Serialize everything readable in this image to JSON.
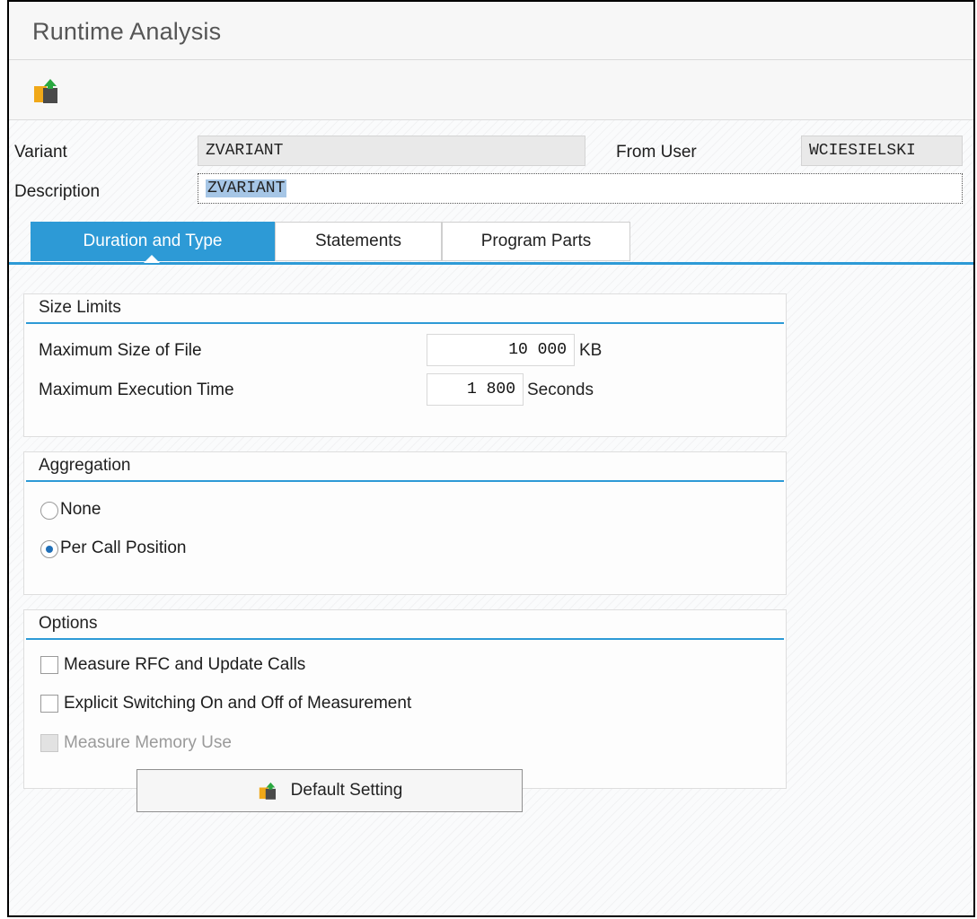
{
  "window": {
    "title": "Runtime Analysis"
  },
  "toolbar": {
    "icon": "get-variant-icon"
  },
  "header": {
    "variant_label": "Variant",
    "variant_value": "ZVARIANT",
    "from_user_label": "From User",
    "from_user_value": "WCIESIELSKI",
    "description_label": "Description",
    "description_value": "ZVARIANT"
  },
  "tabs": [
    {
      "label": "Duration and Type",
      "active": true
    },
    {
      "label": "Statements",
      "active": false
    },
    {
      "label": "Program Parts",
      "active": false
    }
  ],
  "size_limits": {
    "title": "Size Limits",
    "max_file_label": "Maximum Size of File",
    "max_file_value": "10 000",
    "max_file_unit": "KB",
    "max_time_label": "Maximum Execution Time",
    "max_time_value": "1 800",
    "max_time_unit": "Seconds"
  },
  "aggregation": {
    "title": "Aggregation",
    "options": [
      {
        "label": "None",
        "selected": false
      },
      {
        "label": "Per Call Position",
        "selected": true
      }
    ]
  },
  "options": {
    "title": "Options",
    "items": [
      {
        "label": "Measure RFC and Update Calls",
        "checked": false,
        "enabled": true
      },
      {
        "label": "Explicit Switching On and Off of Measurement",
        "checked": false,
        "enabled": true
      },
      {
        "label": "Measure Memory Use",
        "checked": false,
        "enabled": false
      }
    ]
  },
  "footer": {
    "default_button_label": "Default Setting"
  },
  "colors": {
    "accent": "#2d9ad6",
    "selection": "#a6c6e6"
  }
}
